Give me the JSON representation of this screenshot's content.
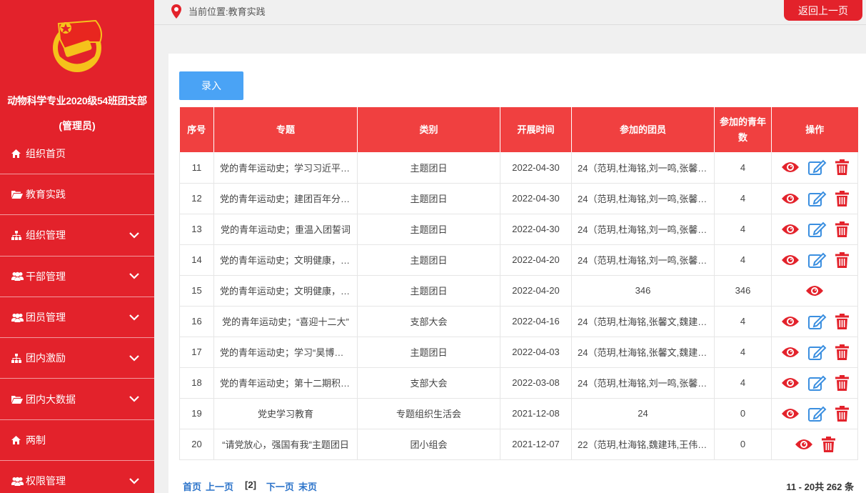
{
  "sidebar": {
    "org_name": "动物科学专业2020级54班团支部",
    "role": "(管理员)",
    "items": [
      {
        "label": "组织首页",
        "icon": "home-icon",
        "expandable": false
      },
      {
        "label": "教育实践",
        "icon": "folder-open-icon",
        "expandable": false
      },
      {
        "label": "组织管理",
        "icon": "sitemap-icon",
        "expandable": true
      },
      {
        "label": "干部管理",
        "icon": "users-icon",
        "expandable": true
      },
      {
        "label": "团员管理",
        "icon": "users-icon",
        "expandable": true
      },
      {
        "label": "团内激励",
        "icon": "sitemap-icon",
        "expandable": true
      },
      {
        "label": "团内大数据",
        "icon": "folder-open-icon",
        "expandable": true
      },
      {
        "label": "两制",
        "icon": "home-icon",
        "expandable": false
      },
      {
        "label": "权限管理",
        "icon": "users-icon",
        "expandable": true
      }
    ]
  },
  "topbar": {
    "location": "当前位置:教育实践",
    "back_label": "返回上一页"
  },
  "toolbar": {
    "add_label": "录入"
  },
  "table": {
    "headers": [
      "序号",
      "专题",
      "类别",
      "开展时间",
      "参加的团员",
      "参加的青年数",
      "操作"
    ],
    "rows": [
      {
        "no": "11",
        "topic": "党的青年运动史；学习习近平…",
        "category": "主题团日",
        "date": "2022-04-30",
        "members": "24（范玥,杜海铭,刘一鸣,张馨…",
        "youth": "4",
        "ops": [
          "view",
          "edit",
          "delete"
        ]
      },
      {
        "no": "12",
        "topic": "党的青年运动史；建团百年分…",
        "category": "主题团日",
        "date": "2022-04-30",
        "members": "24（范玥,杜海铭,刘一鸣,张馨…",
        "youth": "4",
        "ops": [
          "view",
          "edit",
          "delete"
        ]
      },
      {
        "no": "13",
        "topic": "党的青年运动史；重温入团誓词",
        "category": "主题团日",
        "date": "2022-04-30",
        "members": "24（范玥,杜海铭,刘一鸣,张馨…",
        "youth": "4",
        "ops": [
          "view",
          "edit",
          "delete"
        ]
      },
      {
        "no": "14",
        "topic": "党的青年运动史；文明健康，…",
        "category": "主题团日",
        "date": "2022-04-20",
        "members": "24（范玥,杜海铭,刘一鸣,张馨…",
        "youth": "4",
        "ops": [
          "view",
          "edit",
          "delete"
        ]
      },
      {
        "no": "15",
        "topic": "党的青年运动史；文明健康，…",
        "category": "主题团日",
        "date": "2022-04-20",
        "members": "346",
        "youth": "346",
        "ops": [
          "view"
        ]
      },
      {
        "no": "16",
        "topic": "党的青年运动史；“喜迎十二大”",
        "category": "支部大会",
        "date": "2022-04-16",
        "members": "24（范玥,杜海铭,张馨文,魏建…",
        "youth": "4",
        "ops": [
          "view",
          "edit",
          "delete"
        ]
      },
      {
        "no": "17",
        "topic": "党的青年运动史；学习“昊博峰”…",
        "category": "主题团日",
        "date": "2022-04-03",
        "members": "24（范玥,杜海铭,张馨文,魏建…",
        "youth": "4",
        "ops": [
          "view",
          "edit",
          "delete"
        ]
      },
      {
        "no": "18",
        "topic": "党的青年运动史；第十二期积…",
        "category": "支部大会",
        "date": "2022-03-08",
        "members": "24（范玥,杜海铭,刘一鸣,张馨…",
        "youth": "4",
        "ops": [
          "view",
          "edit",
          "delete"
        ]
      },
      {
        "no": "19",
        "topic": "党史学习教育",
        "category": "专题组织生活会",
        "date": "2021-12-08",
        "members": "24",
        "youth": "0",
        "ops": [
          "view",
          "edit",
          "delete"
        ]
      },
      {
        "no": "20",
        "topic": "“请党放心，强国有我”主题团日",
        "category": "团小组会",
        "date": "2021-12-07",
        "members": "22（范玥,杜海铭,魏建玮,王伟,…",
        "youth": "0",
        "ops": [
          "view",
          "delete"
        ]
      }
    ]
  },
  "pagination": {
    "first": "首页",
    "prev": "上一页",
    "current": "[2]",
    "next": "下一页",
    "last": "末页",
    "summary": "11 - 20共 262 条"
  },
  "colors": {
    "brand_red": "#e3222b",
    "header_red": "#f04040",
    "accent_blue": "#4aa3f5"
  }
}
